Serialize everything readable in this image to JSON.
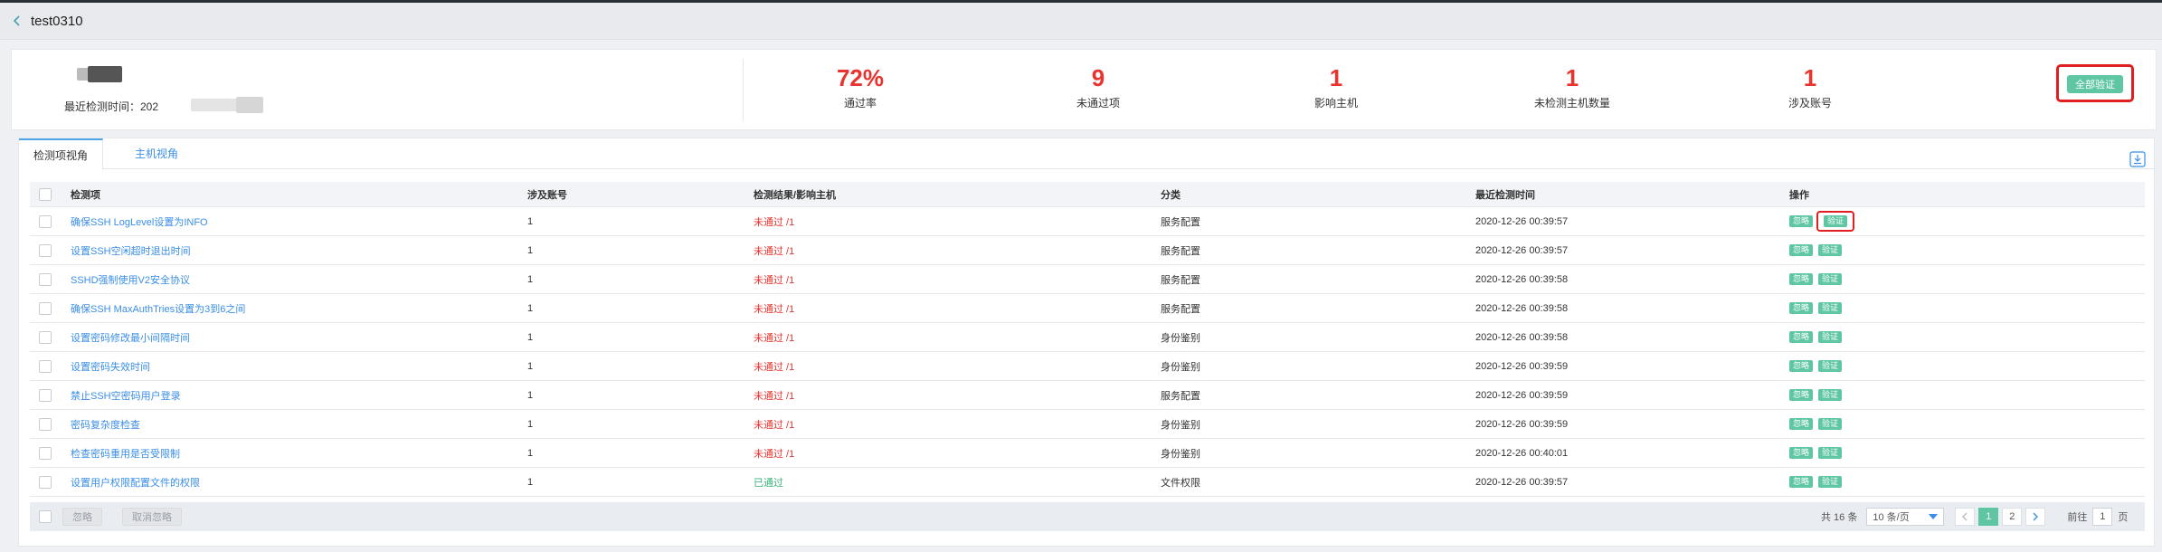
{
  "window": {
    "title": "test0310"
  },
  "summary": {
    "last_check_label": "最近检测时间：202",
    "stats": [
      {
        "value": "72%",
        "label": "通过率"
      },
      {
        "value": "9",
        "label": "未通过项"
      },
      {
        "value": "1",
        "label": "影响主机"
      },
      {
        "value": "1",
        "label": "未检测主机数量"
      },
      {
        "value": "1",
        "label": "涉及账号"
      }
    ],
    "verify_all_label": "全部验证"
  },
  "tabs": [
    {
      "label": "检测项视角",
      "active": true
    },
    {
      "label": "主机视角",
      "active": false
    }
  ],
  "table": {
    "headers": {
      "name": "检测项",
      "account": "涉及账号",
      "result": "检测结果/影响主机",
      "category": "分类",
      "time": "最近检测时间",
      "ops": "操作"
    },
    "ignore_label": "忽略",
    "verify_label": "验证",
    "rows": [
      {
        "name": "确保SSH LogLevel设置为INFO",
        "account": "1",
        "result": "未通过 /1",
        "status": "fail",
        "category": "服务配置",
        "time": "2020-12-26 00:39:57"
      },
      {
        "name": "设置SSH空闲超时退出时间",
        "account": "1",
        "result": "未通过 /1",
        "status": "fail",
        "category": "服务配置",
        "time": "2020-12-26 00:39:57"
      },
      {
        "name": "SSHD强制使用V2安全协议",
        "account": "1",
        "result": "未通过 /1",
        "status": "fail",
        "category": "服务配置",
        "time": "2020-12-26 00:39:58"
      },
      {
        "name": "确保SSH MaxAuthTries设置为3到6之间",
        "account": "1",
        "result": "未通过 /1",
        "status": "fail",
        "category": "服务配置",
        "time": "2020-12-26 00:39:58"
      },
      {
        "name": "设置密码修改最小间隔时间",
        "account": "1",
        "result": "未通过 /1",
        "status": "fail",
        "category": "身份鉴别",
        "time": "2020-12-26 00:39:58"
      },
      {
        "name": "设置密码失效时间",
        "account": "1",
        "result": "未通过 /1",
        "status": "fail",
        "category": "身份鉴别",
        "time": "2020-12-26 00:39:59"
      },
      {
        "name": "禁止SSH空密码用户登录",
        "account": "1",
        "result": "未通过 /1",
        "status": "fail",
        "category": "服务配置",
        "time": "2020-12-26 00:39:59"
      },
      {
        "name": "密码复杂度检查",
        "account": "1",
        "result": "未通过 /1",
        "status": "fail",
        "category": "身份鉴别",
        "time": "2020-12-26 00:39:59"
      },
      {
        "name": "检查密码重用是否受限制",
        "account": "1",
        "result": "未通过 /1",
        "status": "fail",
        "category": "身份鉴别",
        "time": "2020-12-26 00:40:01"
      },
      {
        "name": "设置用户权限配置文件的权限",
        "account": "1",
        "result": "已通过",
        "status": "pass",
        "category": "文件权限",
        "time": "2020-12-26 00:39:57"
      }
    ]
  },
  "footer": {
    "ignore_label": "忽略",
    "unignore_label": "取消忽略",
    "total_label": "共 16 条",
    "page_size_label": "10 条/页",
    "pages": [
      "1",
      "2"
    ],
    "current_page": "1",
    "goto_label": "前往",
    "goto_value": "1",
    "page_suffix": "页"
  },
  "colors": {
    "accent": "#5fc6a3",
    "fail": "#e8342f",
    "pass": "#3bb47c",
    "link": "#3a8ee6",
    "highlight": "#e02020"
  }
}
